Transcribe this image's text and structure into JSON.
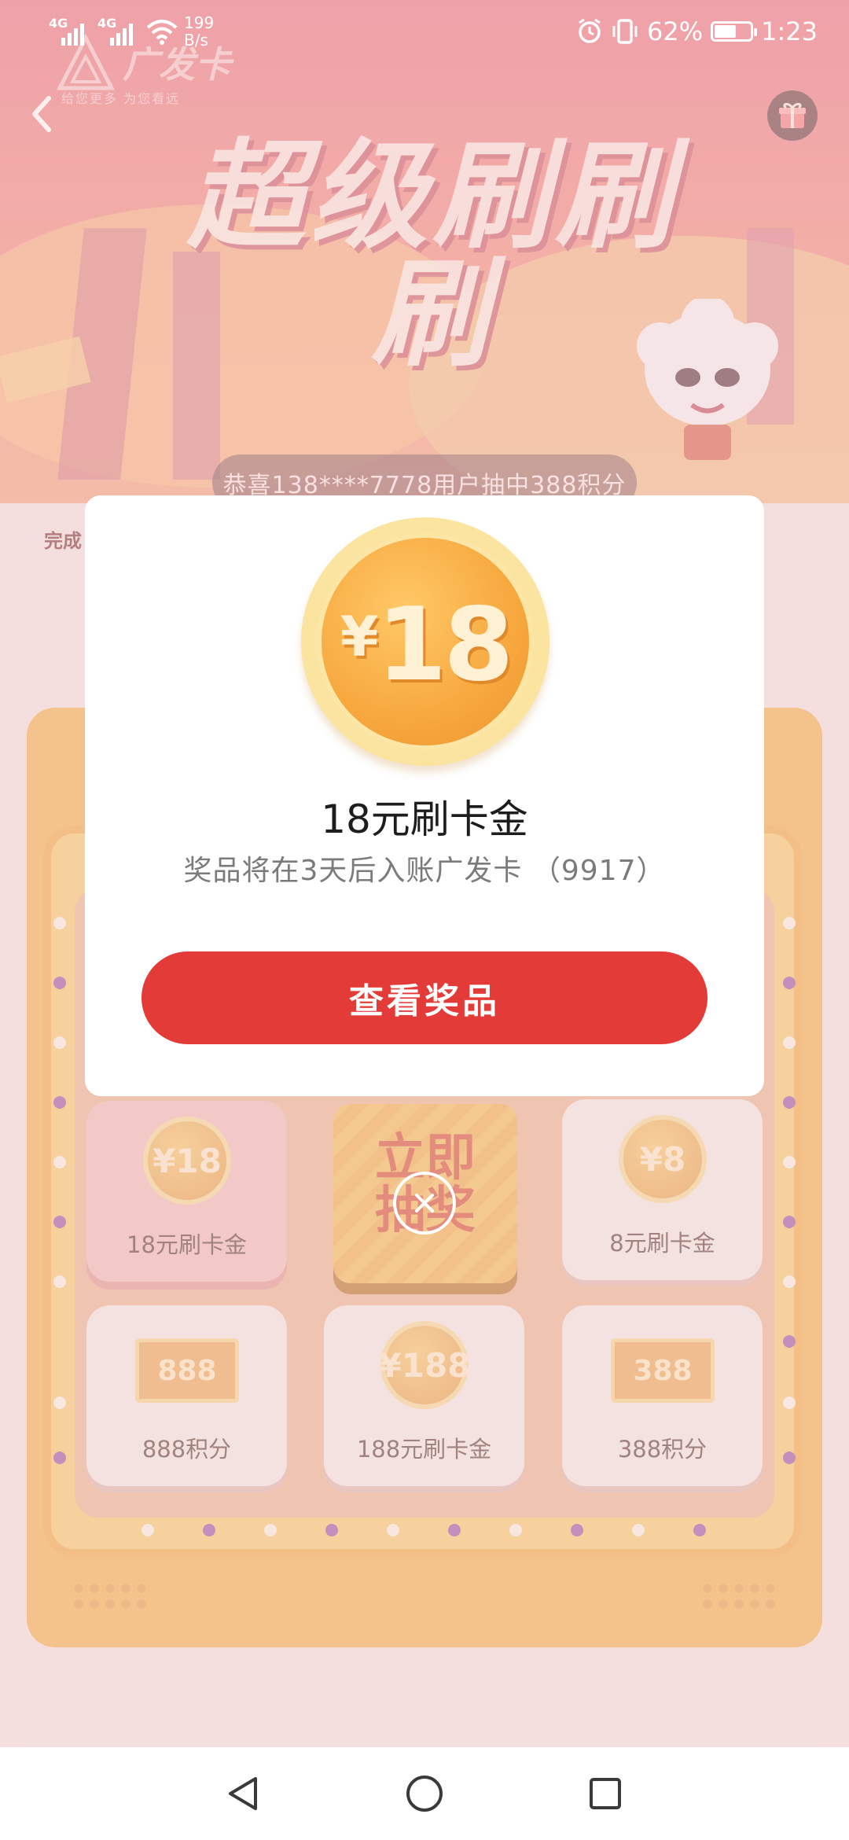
{
  "status_bar": {
    "signal_1_label": "4G",
    "signal_2_label": "4G",
    "net_speed_value": "199",
    "net_speed_unit": "B/s",
    "battery_percent": "62%",
    "battery_level": 0.62,
    "time": "1:23"
  },
  "header": {
    "brand_name": "广发卡",
    "brand_slogan": "给您更多 为您看远",
    "hero_title": "超级刷刷刷"
  },
  "ticker": {
    "text": "恭喜138****7778用户抽中388积分"
  },
  "background": {
    "complete_label": "完成"
  },
  "game": {
    "center_button_label": "立即抽奖",
    "cells": [
      {
        "label": "18元刷卡金",
        "badge": "¥18",
        "kind": "coin"
      },
      {
        "label": "8元刷卡金",
        "badge": "¥8",
        "kind": "coin"
      },
      {
        "label": "888积分",
        "badge": "888",
        "kind": "note"
      },
      {
        "label": "188元刷卡金",
        "badge": "¥188",
        "kind": "coin"
      },
      {
        "label": "388积分",
        "badge": "388",
        "kind": "note"
      }
    ]
  },
  "modal": {
    "coin_symbol": "¥",
    "coin_amount": "18",
    "prize_title": "18元刷卡金",
    "prize_subtitle": "奖品将在3天后入账广发卡 （9917）",
    "view_button": "查看奖品"
  },
  "colors": {
    "primary_button": "#e33b37",
    "coin_gold": "#f7a83e",
    "hero_pink": "#e8707e"
  },
  "icons": {
    "back": "chevron-left-icon",
    "gift": "gift-icon",
    "close": "close-icon",
    "nav_back": "triangle-back-icon",
    "nav_home": "circle-home-icon",
    "nav_recents": "square-recents-icon"
  }
}
